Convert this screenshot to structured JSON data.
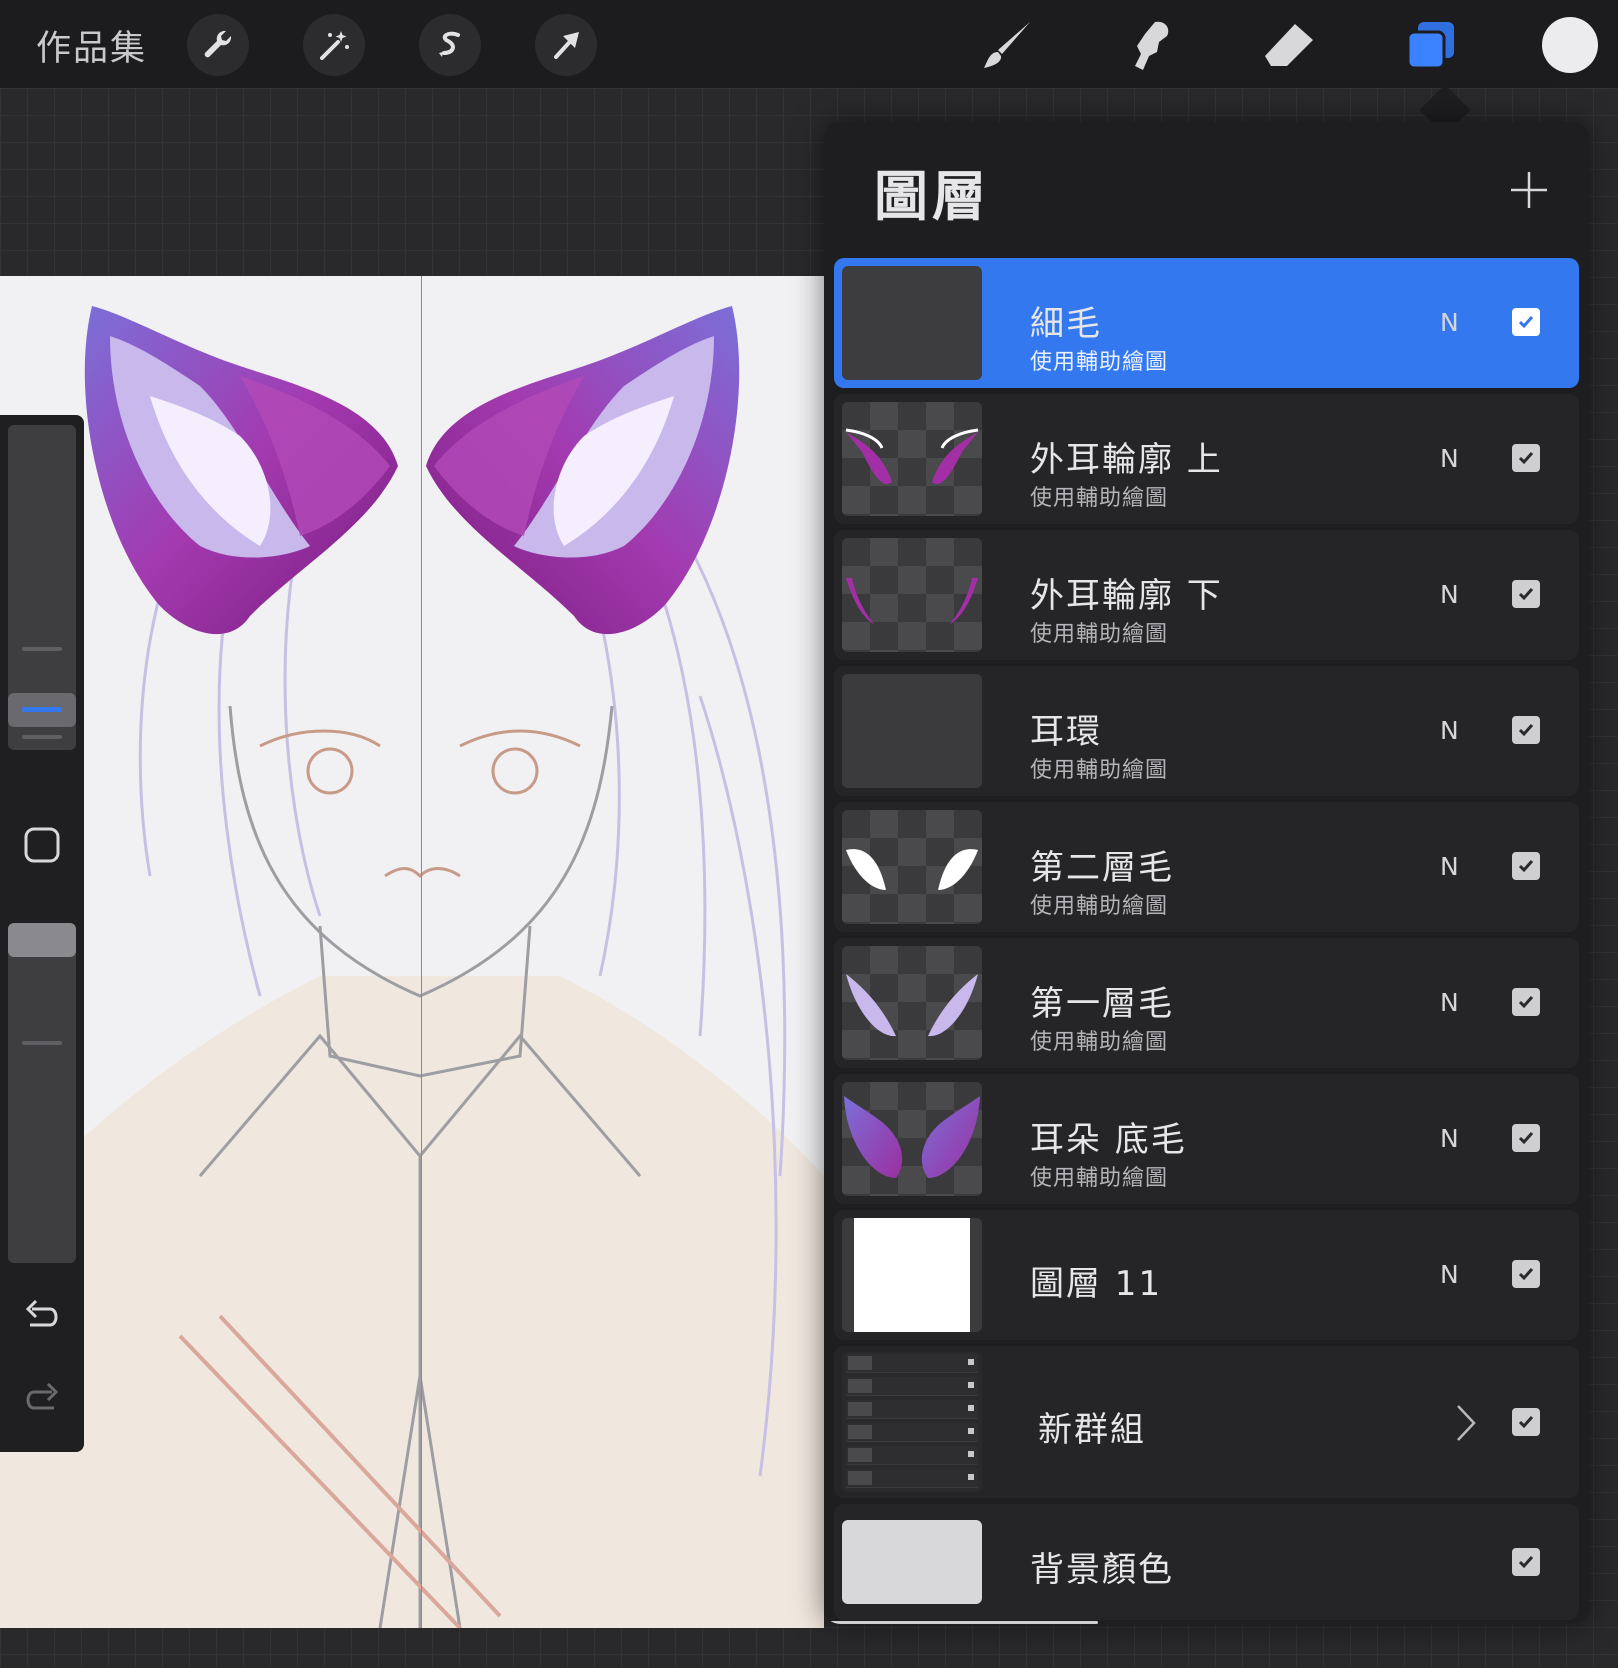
{
  "toolbar": {
    "gallery_label": "作品集",
    "left_tools": [
      "wrench-icon",
      "magic-wand-icon",
      "selection-icon",
      "transform-arrow-icon"
    ],
    "right_tools": [
      "brush-icon",
      "smudge-icon",
      "eraser-icon",
      "layers-icon"
    ],
    "current_color": "#ececee"
  },
  "layers_panel": {
    "title": "圖層",
    "add_icon": "plus-icon",
    "layers": [
      {
        "name": "細毛",
        "sub": "使用輔助繪圖",
        "blend": "N",
        "visible": true,
        "selected": true
      },
      {
        "name": "外耳輪廓 上",
        "sub": "使用輔助繪圖",
        "blend": "N",
        "visible": true
      },
      {
        "name": "外耳輪廓 下",
        "sub": "使用輔助繪圖",
        "blend": "N",
        "visible": true
      },
      {
        "name": "耳環",
        "sub": "使用輔助繪圖",
        "blend": "N",
        "visible": true
      },
      {
        "name": "第二層毛",
        "sub": "使用輔助繪圖",
        "blend": "N",
        "visible": true
      },
      {
        "name": "第一層毛",
        "sub": "使用輔助繪圖",
        "blend": "N",
        "visible": true
      },
      {
        "name": "耳朵 底毛",
        "sub": "使用輔助繪圖",
        "blend": "N",
        "visible": true
      },
      {
        "name": "圖層 11",
        "blend": "N",
        "visible": true
      },
      {
        "name": "新群組",
        "group": true,
        "visible": true
      },
      {
        "name": "背景顏色",
        "visible": true
      }
    ]
  },
  "colors": {
    "accent": "#3478f0",
    "ear_purple": "#9b2fa0",
    "ear_fur_light": "#c9b8ec"
  }
}
